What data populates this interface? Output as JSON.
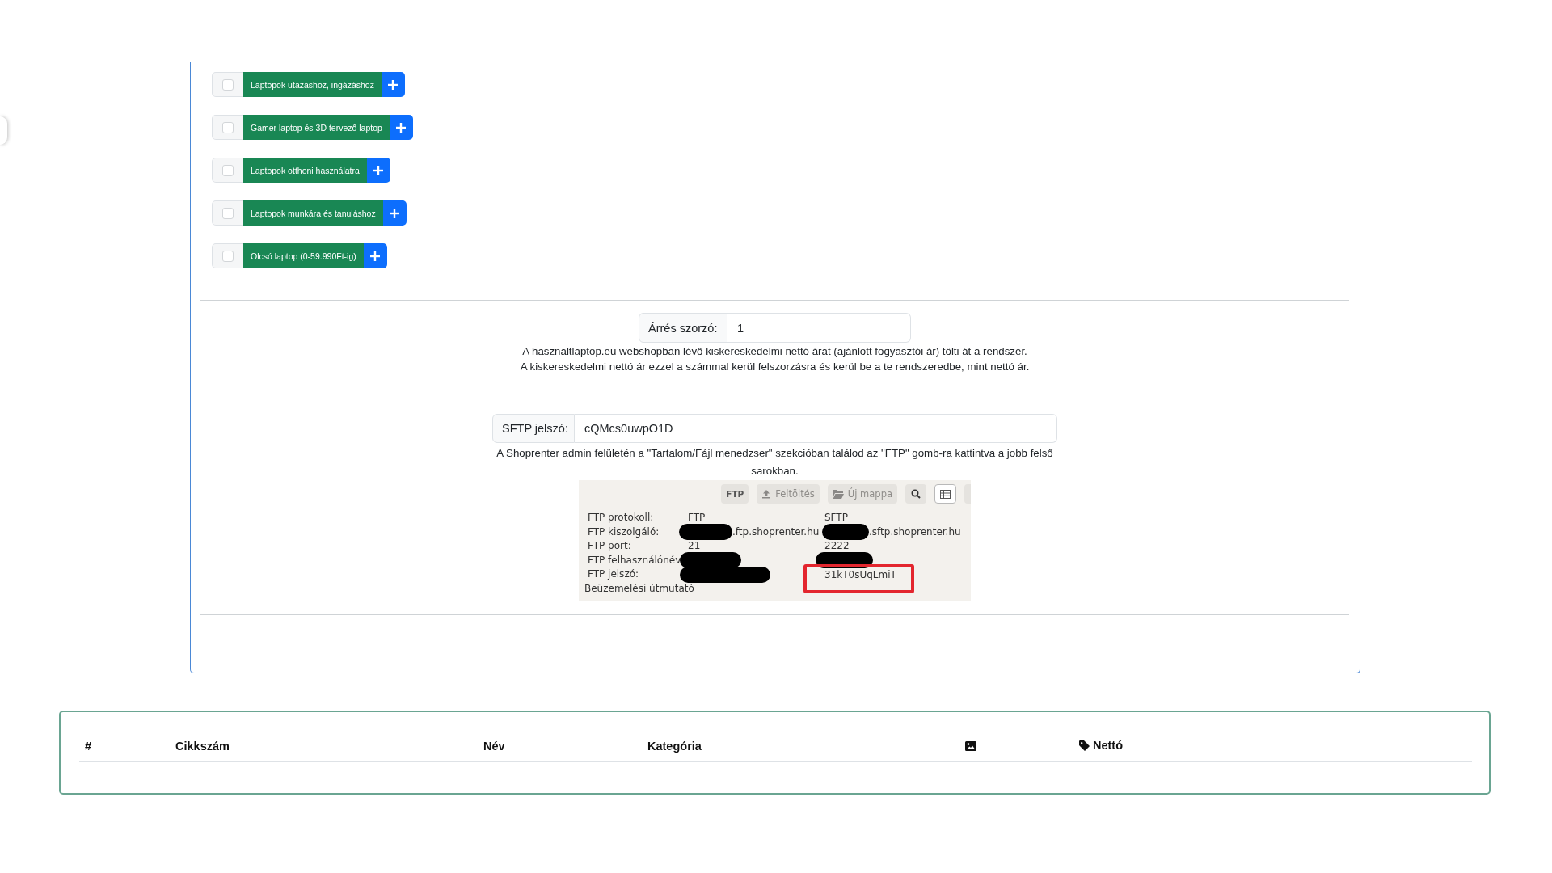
{
  "categories": [
    {
      "label": "Laptopok utazáshoz, ingázáshoz",
      "checked": false
    },
    {
      "label": "Gamer laptop és 3D tervező laptop",
      "checked": false
    },
    {
      "label": "Laptopok otthoni használatra",
      "checked": false
    },
    {
      "label": "Laptopok munkára és tanuláshoz",
      "checked": false
    },
    {
      "label": "Olcsó laptop (0-59.990Ft-ig)",
      "checked": false
    }
  ],
  "margin": {
    "label": "Árrés szorzó:",
    "value": "1",
    "help": [
      "A hasznaltlaptop.eu webshopban lévő kiskereskedelmi nettó árat (ajánlott fogyasztói ár) tölti át a rendszer.",
      "A kiskereskedelmi nettó ár ezzel a számmal kerül felszorzásra és kerül be a te rendszeredbe, mint nettó ár."
    ]
  },
  "sftp": {
    "label": "SFTP jelszó:",
    "value": "cQMcs0uwpO1D",
    "help": "A Shoprenter admin felületén a \"Tartalom/Fájl menedzser\" szekcióban találod az \"FTP\" gomb-ra kattintva a jobb felső sarokban.",
    "screenshot": {
      "toolbar": [
        "FTP",
        "Feltöltés",
        "Új mappa"
      ],
      "rows": [
        {
          "label": "FTP protokoll:",
          "values": [
            {
              "text": "FTP",
              "redacted": false,
              "highlighted": false
            },
            {
              "text": "SFTP",
              "redacted": false,
              "highlighted": false
            }
          ]
        },
        {
          "label": "FTP kiszolgáló:",
          "values": [
            {
              "text": ".ftp.shoprenter.hu",
              "redacted": true,
              "highlighted": false
            },
            {
              "text": ".sftp.shoprenter.hu",
              "redacted": true,
              "highlighted": false
            }
          ]
        },
        {
          "label": "FTP port:",
          "values": [
            {
              "text": "21",
              "redacted": false,
              "highlighted": false
            },
            {
              "text": "2222",
              "redacted": false,
              "highlighted": false
            }
          ]
        },
        {
          "label": "FTP felhasználónév",
          "values": [
            {
              "redacted": true,
              "highlighted": false
            },
            {
              "redacted": true,
              "highlighted": false
            }
          ]
        },
        {
          "label": "FTP jelszó:",
          "values": [
            {
              "redacted": true,
              "highlighted": false
            },
            {
              "text": "31kT0sUqLmiT",
              "redacted": false,
              "highlighted": true
            }
          ]
        }
      ],
      "link": "Beüzemelési útmutató"
    }
  },
  "table": {
    "columns": [
      {
        "kind": "text",
        "label": "#"
      },
      {
        "kind": "text",
        "label": "Cikkszám"
      },
      {
        "kind": "text",
        "label": "Név"
      },
      {
        "kind": "text",
        "label": "Kategória"
      },
      {
        "kind": "icon"
      },
      {
        "kind": "icon_text",
        "label": "Nettó"
      }
    ]
  }
}
